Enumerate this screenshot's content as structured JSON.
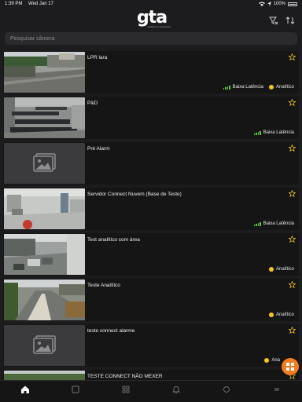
{
  "status_bar": {
    "time": "1:39 PM",
    "date": "Wed Jan 17",
    "battery": "100%",
    "icons": [
      "wifi-icon",
      "location-icon",
      "battery-icon"
    ]
  },
  "header": {
    "logo_text": "gta",
    "logo_tagline": "gestão em segurança",
    "icons": [
      "filter-icon",
      "sort-icon"
    ]
  },
  "search": {
    "placeholder": "Pesquisar câmera"
  },
  "colors": {
    "background": "#1c1c1e",
    "card": "#151515",
    "low_latency_green": "#5ec73a",
    "analytic_yellow": "#f5c518",
    "accent_orange": "#f47c20",
    "star_outline": "#f5c518"
  },
  "cameras": [
    {
      "name": "LPR lara",
      "thumbnail": "street",
      "latency": "Baixa Latência",
      "analytic": "Analítico"
    },
    {
      "name": "P&D",
      "thumbnail": "office",
      "latency": "Baixa Latência",
      "analytic": ""
    },
    {
      "name": "Pré Alarm",
      "thumbnail": "placeholder",
      "latency": "",
      "analytic": ""
    },
    {
      "name": "Servidor Connect Nuvem (Base de Teste)",
      "thumbnail": "room",
      "latency": "Baixa Latência",
      "analytic": ""
    },
    {
      "name": "Test analítico com área",
      "thumbnail": "parking",
      "latency": "",
      "analytic": "Analítico"
    },
    {
      "name": "Teste Analítico",
      "thumbnail": "road",
      "latency": "",
      "analytic": "Analítico"
    },
    {
      "name": "teste connect alarme",
      "thumbnail": "placeholder",
      "latency": "",
      "analytic": "Ana"
    },
    {
      "name": "TESTE CONNECT NÃO MEXER",
      "thumbnail": "garden",
      "latency": "",
      "analytic": ""
    }
  ],
  "tab_bar": {
    "tabs": [
      "home-icon",
      "tablet-icon",
      "grid-icon",
      "bell-icon",
      "circle-icon",
      "menu-icon"
    ],
    "active": "home-icon"
  },
  "fab": {
    "icon": "camera-grid-icon"
  }
}
